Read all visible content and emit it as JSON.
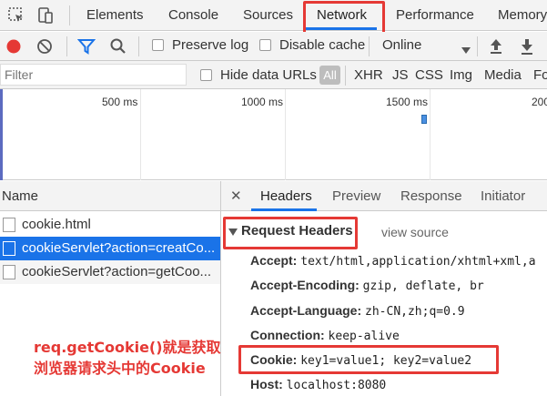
{
  "tabs": {
    "items": [
      {
        "label": "Elements"
      },
      {
        "label": "Console"
      },
      {
        "label": "Sources"
      },
      {
        "label": "Network"
      },
      {
        "label": "Performance"
      },
      {
        "label": "Memory"
      }
    ],
    "active": "Network"
  },
  "toolbar": {
    "preserve_log_label": "Preserve log",
    "disable_cache_label": "Disable cache",
    "throttle_value": "Online",
    "icons": [
      "record-icon",
      "clear-icon",
      "filter-icon",
      "search-icon",
      "dropdown-icon",
      "upload-icon",
      "download-icon"
    ]
  },
  "filterbar": {
    "placeholder": "Filter",
    "hide_data_urls_label": "Hide data URLs",
    "all_label": "All",
    "types": [
      "XHR",
      "JS",
      "CSS",
      "Img",
      "Media",
      "Fo"
    ]
  },
  "timeline": {
    "labels": [
      "500 ms",
      "1000 ms",
      "1500 ms",
      "200"
    ]
  },
  "requests": {
    "header": "Name",
    "items": [
      {
        "name": "cookie.html"
      },
      {
        "name": "cookieServlet?action=creatCo..."
      },
      {
        "name": "cookieServlet?action=getCoo..."
      }
    ],
    "selected_index": 1
  },
  "details": {
    "tabs": [
      {
        "label": "Headers"
      },
      {
        "label": "Preview"
      },
      {
        "label": "Response"
      },
      {
        "label": "Initiator"
      }
    ],
    "active_tab": "Headers",
    "section_title": "Request Headers",
    "view_source": "view source",
    "headers": [
      {
        "key": "Accept:",
        "value": "text/html,application/xhtml+xml,a"
      },
      {
        "key": "Accept-Encoding:",
        "value": "gzip, deflate, br"
      },
      {
        "key": "Accept-Language:",
        "value": "zh-CN,zh;q=0.9"
      },
      {
        "key": "Connection:",
        "value": "keep-alive"
      },
      {
        "key": "Cookie:",
        "value": "key1=value1; key2=value2"
      },
      {
        "key": "Host:",
        "value": "localhost:8080"
      }
    ]
  },
  "annotation": {
    "line1": "req.getCookie()就是获取",
    "line2": "浏览器请求头中的Cookie"
  },
  "colors": {
    "accent": "#1a73e8",
    "highlight_red": "#e53935",
    "record_red": "#e53935"
  }
}
